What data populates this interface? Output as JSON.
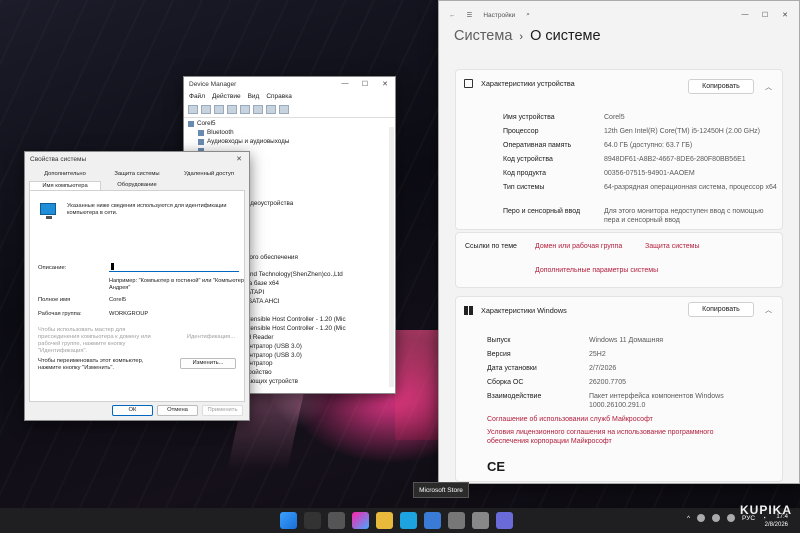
{
  "devmgr": {
    "title": "Device Manager",
    "menu": [
      "Файл",
      "Действие",
      "Вид",
      "Справка"
    ],
    "tree": [
      "Corel5",
      "Bluetooth",
      "Аудиовходы и аудиовыходы",
      "...",
      "...",
      "...ьютер",
      "...стройства",
      "...",
      "...",
      "...ктивные и видеоустройства",
      "...",
      "...",
      "...",
      "...ойств",
      "...ммы",
      "...и программного обеспечения",
      "...",
      "...l Innovation And Technology(ShenZhen)co.,Ltd",
      "...тор с ACPI на базе x64",
      "...ры IDE ATA/ATAPI",
      "...контроллер SATA AHCI",
      "...еры USB",
      "...USB 3.10 eXtensible Host Controller - 1.20 (Mic",
      "...USB 3.20 eXtensible Host Controller - 1.20 (Mic",
      "...USB 2.0 Card Reader",
      "...й USB-концентратор (USB 3.0)",
      "...й USB-концентратор (USB 3.0)",
      "...й USB-концентратор",
      "...ное USB устройство",
      "...ва, запоминающих устройств"
    ]
  },
  "sysprops": {
    "title": "Свойства системы",
    "tabs": [
      "Дополнительно",
      "Защита системы",
      "Удаленный доступ",
      "Имя компьютера",
      "Оборудование"
    ],
    "description": "Указанные ниже сведения используются для идентификации компьютера в сети.",
    "description_label": "Описание:",
    "example": "Например: \"Компьютер в гостиной\" или \"Компьютер Андрея\"",
    "full_name_label": "Полное имя",
    "full_name_value": "Corel5",
    "workgroup_label": "Рабочая группа:",
    "workgroup_value": "WORKGROUP",
    "wizard_text": "Чтобы использовать мастер для присоединения компьютера к домену или рабочей группе, нажмите кнопку \"Идентификация\".",
    "identify_button": "Идентификация...",
    "rename_text": "Чтобы переименовать этот компьютер, нажмите кнопку \"Изменить\".",
    "change_button": "Изменить...",
    "ok": "ОК",
    "cancel": "Отмена",
    "apply": "Применить"
  },
  "settings": {
    "app_title": "Настройки",
    "crumb_parent": "Система",
    "crumb_current": "О системе",
    "device_card": {
      "title": "Характеристики устройства",
      "copy": "Копировать",
      "rows": [
        {
          "k": "Имя устройства",
          "v": "Corel5"
        },
        {
          "k": "Процессор",
          "v": "12th Gen Intel(R) Core(TM) i5-12450H (2.00 GHz)"
        },
        {
          "k": "Оперативная память",
          "v": "64.0 ГБ (доступно: 63.7 ГБ)"
        },
        {
          "k": "Код устройства",
          "v": "8948DF61-A8B2-4667-8DE6-280F80BB56E1"
        },
        {
          "k": "Код продукта",
          "v": "00356-07515-94901-AAOEM"
        },
        {
          "k": "Тип системы",
          "v": "64-разрядная операционная система, процессор x64"
        },
        {
          "k": "Перо и сенсорный ввод",
          "v": "Для этого монитора недоступен ввод с помощью пера и сенсорный ввод"
        }
      ]
    },
    "related": {
      "label": "Ссылки по теме",
      "links": [
        "Домен или рабочая группа",
        "Защита системы",
        "Дополнительные параметры системы"
      ]
    },
    "windows_card": {
      "title": "Характеристики Windows",
      "copy": "Копировать",
      "rows": [
        {
          "k": "Выпуск",
          "v": "Windows 11 Домашняя"
        },
        {
          "k": "Версия",
          "v": "25H2"
        },
        {
          "k": "Дата установки",
          "v": "2/7/2026"
        },
        {
          "k": "Сборка ОС",
          "v": "26200.7705"
        },
        {
          "k": "Взаимодействие",
          "v": "Пакет интерфейса компонентов Windows 1000.26100.291.0"
        }
      ],
      "links": [
        "Соглашение об использовании служб Майкрософт",
        "Условия лицензионного соглашения на использование программного обеспечения корпорации Майкрософт"
      ],
      "ce": "CE"
    }
  },
  "tooltip": "Microsoft Store",
  "taskbar": {
    "lang": "РУС",
    "time": "17:4",
    "date": "2/8/2026",
    "watermark": "KUPIKA"
  },
  "colors": {
    "accent": "#0067c0",
    "link": "#b3203d"
  }
}
